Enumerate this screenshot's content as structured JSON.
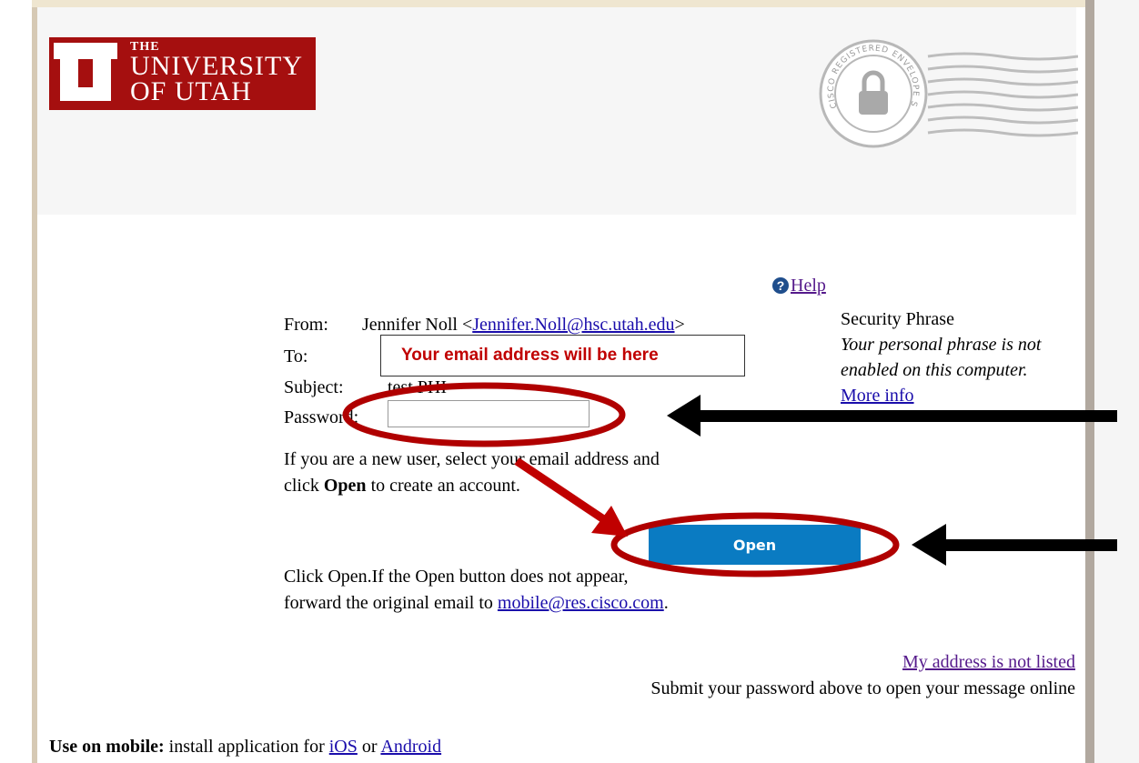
{
  "logo": {
    "line1": "THE",
    "line2": "UNIVERSITY",
    "line3": "OF UTAH"
  },
  "seal": {
    "text": "CISCO REGISTERED ENVELOPE SERVICE"
  },
  "help": {
    "label": "Help"
  },
  "message": {
    "from_label": "From:",
    "from_name": "Jennifer Noll <",
    "from_email": "Jennifer.Noll@hsc.utah.edu",
    "from_close": ">",
    "to_label": "To:",
    "subject_label": "Subject:",
    "subject_value": "test PHI",
    "password_label": "Password:",
    "password_value": ""
  },
  "instructions": {
    "new_user_part1": "If you are a new user, select your email address and click ",
    "new_user_bold": "Open",
    "new_user_part2": " to create an account.",
    "forward_text": "Click Open.If the Open button does not appear, forward the original email to ",
    "forward_link": "mobile@res.cisco.com",
    "forward_end": "."
  },
  "open_button": {
    "label": "Open"
  },
  "security": {
    "title": "Security Phrase",
    "body": "Your personal phrase is not enabled on this computer.",
    "more_info": "More info"
  },
  "footer": {
    "not_listed": "My address is not listed",
    "submit_text": "Submit your password above to open your message online",
    "mobile_label": "Use on mobile:",
    "mobile_text": " install application for ",
    "ios": "iOS",
    "or": " or ",
    "android": "Android"
  },
  "annotation": {
    "email_note": "Your email address will be here"
  },
  "colors": {
    "utah_red": "#a50f0f",
    "open_button": "#0a7bc2",
    "annotation_red": "#b00000"
  }
}
